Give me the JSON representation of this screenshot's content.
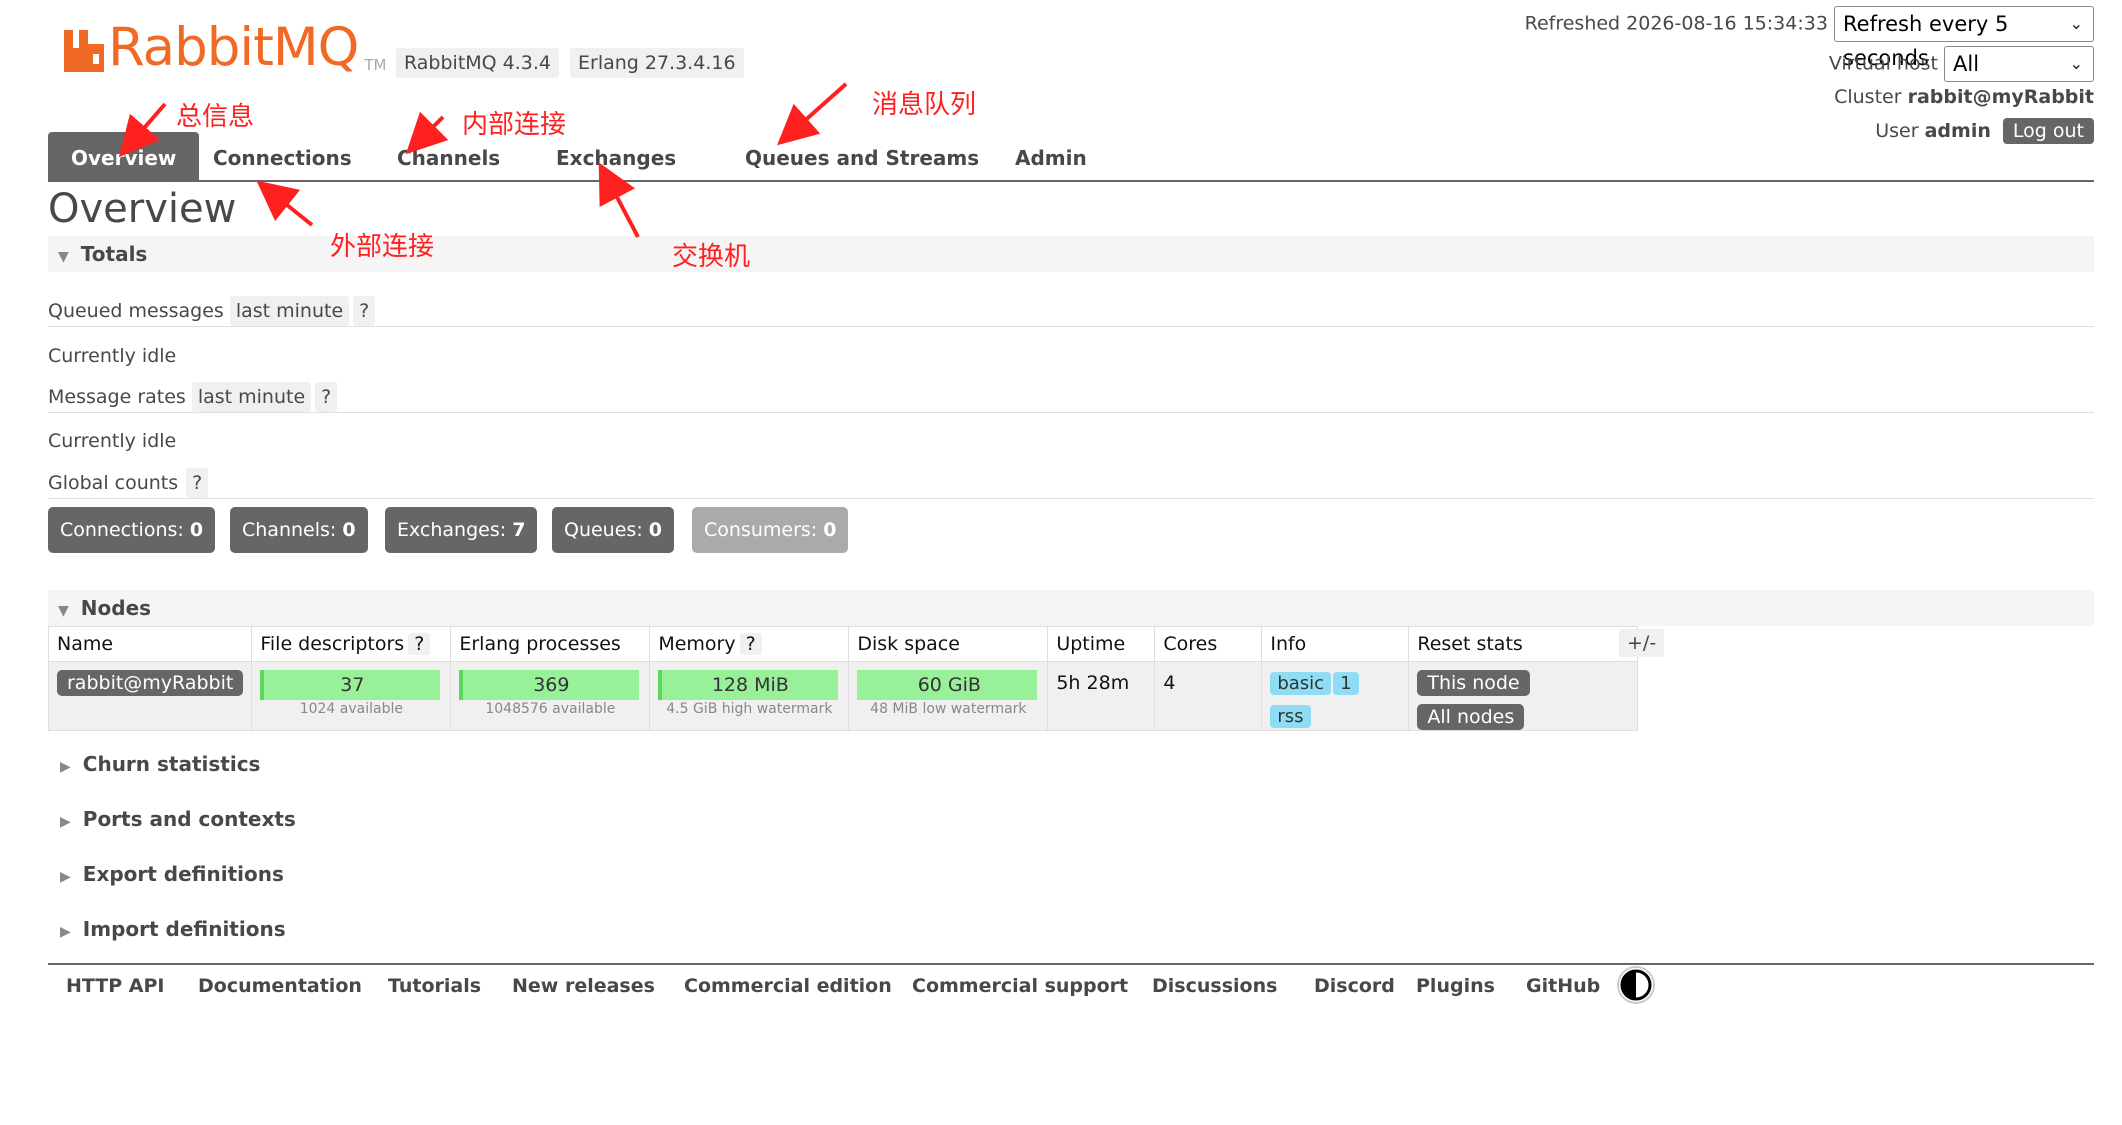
{
  "header": {
    "logo_text": "RabbitMQ",
    "logo_tm": "TM",
    "rabbitmq_version": "RabbitMQ 4.3.4",
    "erlang_version": "Erlang 27.3.4.16",
    "refreshed_label": "Refreshed 2026-08-16 15:34:33",
    "refresh_select_value": "Refresh every 5 seconds",
    "virtual_host_label": "Virtual host",
    "virtual_host_value": "All",
    "cluster_label": "Cluster",
    "cluster_value": "rabbit@myRabbit",
    "user_label": "User",
    "user_value": "admin",
    "logout_label": "Log out"
  },
  "tabs": [
    {
      "label": "Overview",
      "active": true
    },
    {
      "label": "Connections"
    },
    {
      "label": "Channels"
    },
    {
      "label": "Exchanges"
    },
    {
      "label": "Queues and Streams"
    },
    {
      "label": "Admin"
    }
  ],
  "page_title": "Overview",
  "totals": {
    "heading": "Totals",
    "queued_messages_label": "Queued messages",
    "queued_messages_range": "last minute",
    "help": "?",
    "queued_status": "Currently idle",
    "message_rates_label": "Message rates",
    "message_rates_range": "last minute",
    "rates_status": "Currently idle",
    "global_counts_label": "Global counts",
    "counts": [
      {
        "label": "Connections:",
        "value": "0"
      },
      {
        "label": "Channels:",
        "value": "0"
      },
      {
        "label": "Exchanges:",
        "value": "7"
      },
      {
        "label": "Queues:",
        "value": "0"
      },
      {
        "label": "Consumers:",
        "value": "0"
      }
    ]
  },
  "nodes": {
    "heading": "Nodes",
    "columns": [
      "Name",
      "File descriptors",
      "Erlang processes",
      "Memory",
      "Disk space",
      "Uptime",
      "Cores",
      "Info",
      "Reset stats"
    ],
    "toggle_label": "+/-",
    "row": {
      "name": "rabbit@myRabbit",
      "file_descriptors": "37",
      "file_descriptors_sub": "1024 available",
      "erlang_processes": "369",
      "erlang_processes_sub": "1048576 available",
      "memory": "128 MiB",
      "memory_sub": "4.5 GiB high watermark",
      "disk_space": "60 GiB",
      "disk_space_sub": "48 MiB low watermark",
      "uptime": "5h 28m",
      "cores": "4",
      "info_tags": [
        "basic",
        "1",
        "rss"
      ],
      "reset_this_node": "This node",
      "reset_all_nodes": "All nodes"
    }
  },
  "collapsed_sections": [
    "Churn statistics",
    "Ports and contexts",
    "Export definitions",
    "Import definitions"
  ],
  "footer_links": [
    "HTTP API",
    "Documentation",
    "Tutorials",
    "New releases",
    "Commercial edition",
    "Commercial support",
    "Discussions",
    "Discord",
    "Plugins",
    "GitHub"
  ],
  "annotations": {
    "overview": "总信息",
    "channels": "内部连接",
    "queues": "消息队列",
    "connections": "外部连接",
    "exchanges": "交换机"
  },
  "colors": {
    "brand_orange": "#f06a26",
    "tab_active": "#666666",
    "bar_green": "#98f098",
    "info_blue": "#8fdcf5",
    "annotation_red": "#ff2020"
  }
}
